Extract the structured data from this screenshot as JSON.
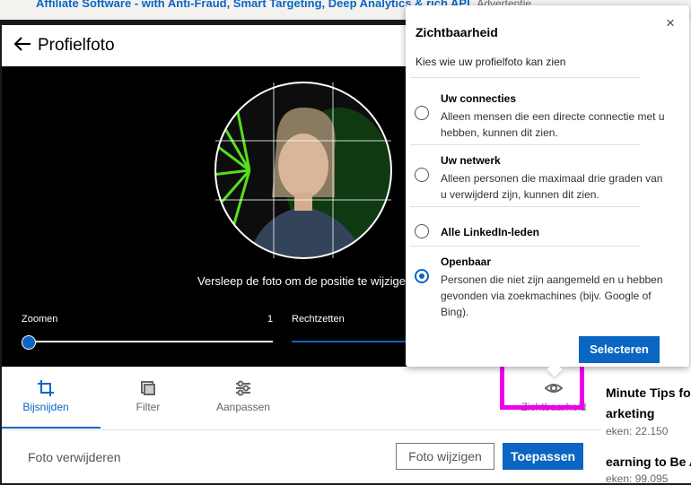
{
  "background": {
    "ad_title": "Affiliate Software - with Anti-Fraud, Smart Targeting, Deep Analytics & rich API.",
    "ad_label": "Advertentie",
    "post1_line1": "Minute Tips fo",
    "post1_line2": "arketing",
    "post1_views": "eken: 22.150",
    "post2_line1": "earning to Be A",
    "post2_views": "eken: 99.095"
  },
  "modal": {
    "title": "Profielfoto",
    "hint": "Versleep de foto om de positie te wijzigen",
    "zoom_label": "Zoomen",
    "zoom_value": "1",
    "straighten_label": "Rechtzetten",
    "tools": [
      {
        "label": "Bijsnijden",
        "icon": "crop-icon",
        "active": true
      },
      {
        "label": "Filter",
        "icon": "filter-icon",
        "active": false
      },
      {
        "label": "Aanpassen",
        "icon": "sliders-icon",
        "active": false
      },
      {
        "label": "Zichtbaarheid",
        "icon": "eye-icon",
        "active": false
      }
    ],
    "remove_label": "Foto verwijderen",
    "change_label": "Foto wijzigen",
    "apply_label": "Toepassen"
  },
  "popup": {
    "title": "Zichtbaarheid",
    "subtitle": "Kies wie uw profielfoto kan zien",
    "close": "×",
    "options": [
      {
        "title": "Uw connecties",
        "desc": "Alleen mensen die een directe connectie met u hebben, kunnen dit zien.",
        "selected": false
      },
      {
        "title": "Uw netwerk",
        "desc": "Alleen personen die maximaal drie graden van u verwijderd zijn, kunnen dit zien.",
        "selected": false
      },
      {
        "title": "Alle LinkedIn-leden",
        "desc": "",
        "selected": false
      },
      {
        "title": "Openbaar",
        "desc": "Personen die niet zijn aangemeld en u hebben gevonden via zoekmachines (bijv. Google of Bing).",
        "selected": true
      }
    ],
    "select_label": "Selecteren"
  },
  "colors": {
    "accent": "#0a66c2",
    "highlight": "#ee00ee"
  }
}
